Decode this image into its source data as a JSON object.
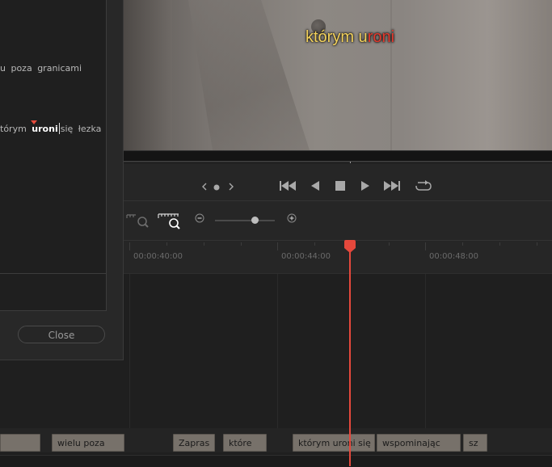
{
  "dialog": {
    "line1": "u poza granicami",
    "line2_pre": "tórym",
    "line2_highlight": "uroni",
    "line2_post": "się łezka",
    "close_label": "Close"
  },
  "viewer": {
    "subtitle_yellow": "którym u",
    "subtitle_red": "roni",
    "colors": {
      "subtitle_yellow": "#f2d15c",
      "subtitle_red": "#e23a2e"
    }
  },
  "transport": {
    "icons": [
      "prev-frame-icon",
      "dot-icon",
      "next-frame-icon",
      "skip-back-icon",
      "play-reverse-icon",
      "stop-icon",
      "play-icon",
      "skip-forward-icon",
      "loop-icon"
    ]
  },
  "zoom": {
    "minus": "−",
    "plus": "+",
    "level": 0.6
  },
  "ruler": {
    "timecodes": [
      "00:00:40:00",
      "00:00:44:00",
      "00:00:48:00"
    ]
  },
  "clips": [
    {
      "label": ""
    },
    {
      "label": "wielu poza"
    },
    {
      "label": "Zapras"
    },
    {
      "label": "które"
    },
    {
      "label": "którym uroni się"
    },
    {
      "label": "wspominając"
    },
    {
      "label": "sz"
    }
  ],
  "accent_color": "#e5483c"
}
